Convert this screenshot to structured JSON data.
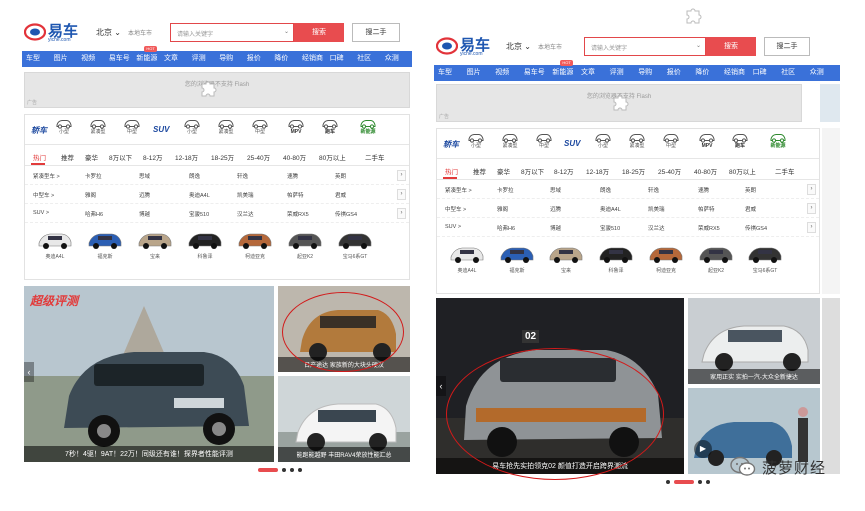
{
  "site": {
    "logo_text": "易车",
    "logo_sub": "yiche.com",
    "city": "北京",
    "city_hint": "本地车市",
    "search_placeholder": "请输入关键字",
    "search_button": "搜索",
    "used_button": "搜二手"
  },
  "nav": {
    "left": [
      "车型",
      "图片",
      "视频",
      "易车号",
      "新能源",
      "文章",
      "评测",
      "导购",
      "报价",
      "降价",
      "经销商",
      "口碑",
      "社区",
      "众测"
    ],
    "right": [
      "车型",
      "图片",
      "视频",
      "易车号",
      "新能源",
      "文章",
      "评测",
      "导购",
      "报价",
      "降价",
      "经销商",
      "口碑",
      "社区",
      "众测"
    ],
    "badge": "HOT"
  },
  "flash": {
    "text_left": "您的浏览器不支持 Flash",
    "text_right": "您的浏览器不支持 Flash",
    "corner": "广告"
  },
  "car_types": {
    "group_sedan": "轿车",
    "group_suv": "SUV",
    "items": [
      {
        "label": "小型"
      },
      {
        "label": "紧凑型"
      },
      {
        "label": "中型"
      },
      {
        "label": "小型"
      },
      {
        "label": "紧凑型"
      },
      {
        "label": "中型"
      },
      {
        "label": "MPV"
      },
      {
        "label": "跑车"
      },
      {
        "label": "新能源"
      }
    ]
  },
  "price_tabs": [
    "热门",
    "推荐",
    "豪华",
    "8万以下",
    "8-12万",
    "12-18万",
    "18-25万",
    "25-40万",
    "40-80万",
    "80万以上",
    "二手车"
  ],
  "model_rows": [
    {
      "label": "紧凑型车 >",
      "cells": [
        "卡罗拉",
        "思域",
        "朗逸",
        "轩逸",
        "速腾",
        "英朗"
      ]
    },
    {
      "label": "中型车 >",
      "cells": [
        "雅阁",
        "迈腾",
        "奥迪A4L",
        "凯美瑞",
        "帕萨特",
        "君威"
      ]
    },
    {
      "label": "SUV >",
      "cells": [
        "哈弗H6",
        "博越",
        "宝骏510",
        "汉兰达",
        "荣威RX5",
        "传祺GS4"
      ]
    }
  ],
  "cars": [
    "奥迪A4L",
    "福克斯",
    "宝来",
    "科鲁泽",
    "柯迪亚克",
    "起亚K2",
    "宝马6系GT"
  ],
  "slides": {
    "left_main_caption": "7秒！4驱！9AT！22万！同级还有谁！探界者性能评测",
    "left_main_badge": "超级评测",
    "left_top_caption": "日产途达 家族新的大块头硬汉",
    "left_bottom_caption": "能跑能越野 丰田RAV4荣放性能汇总",
    "right_main_caption": "易车抢先实拍领克02 颜值打造开启跨界潮流",
    "right_main_badge": "02",
    "right_top_caption": "家用正实 实拍一汽-大众全新捷达"
  },
  "watermark": {
    "text": "菠萝财经",
    "icon": "wechat-icon"
  },
  "colors": {
    "nav_blue": "#3a71d9",
    "accent_red": "#e84c4f",
    "ring_red": "#d21a1a"
  }
}
